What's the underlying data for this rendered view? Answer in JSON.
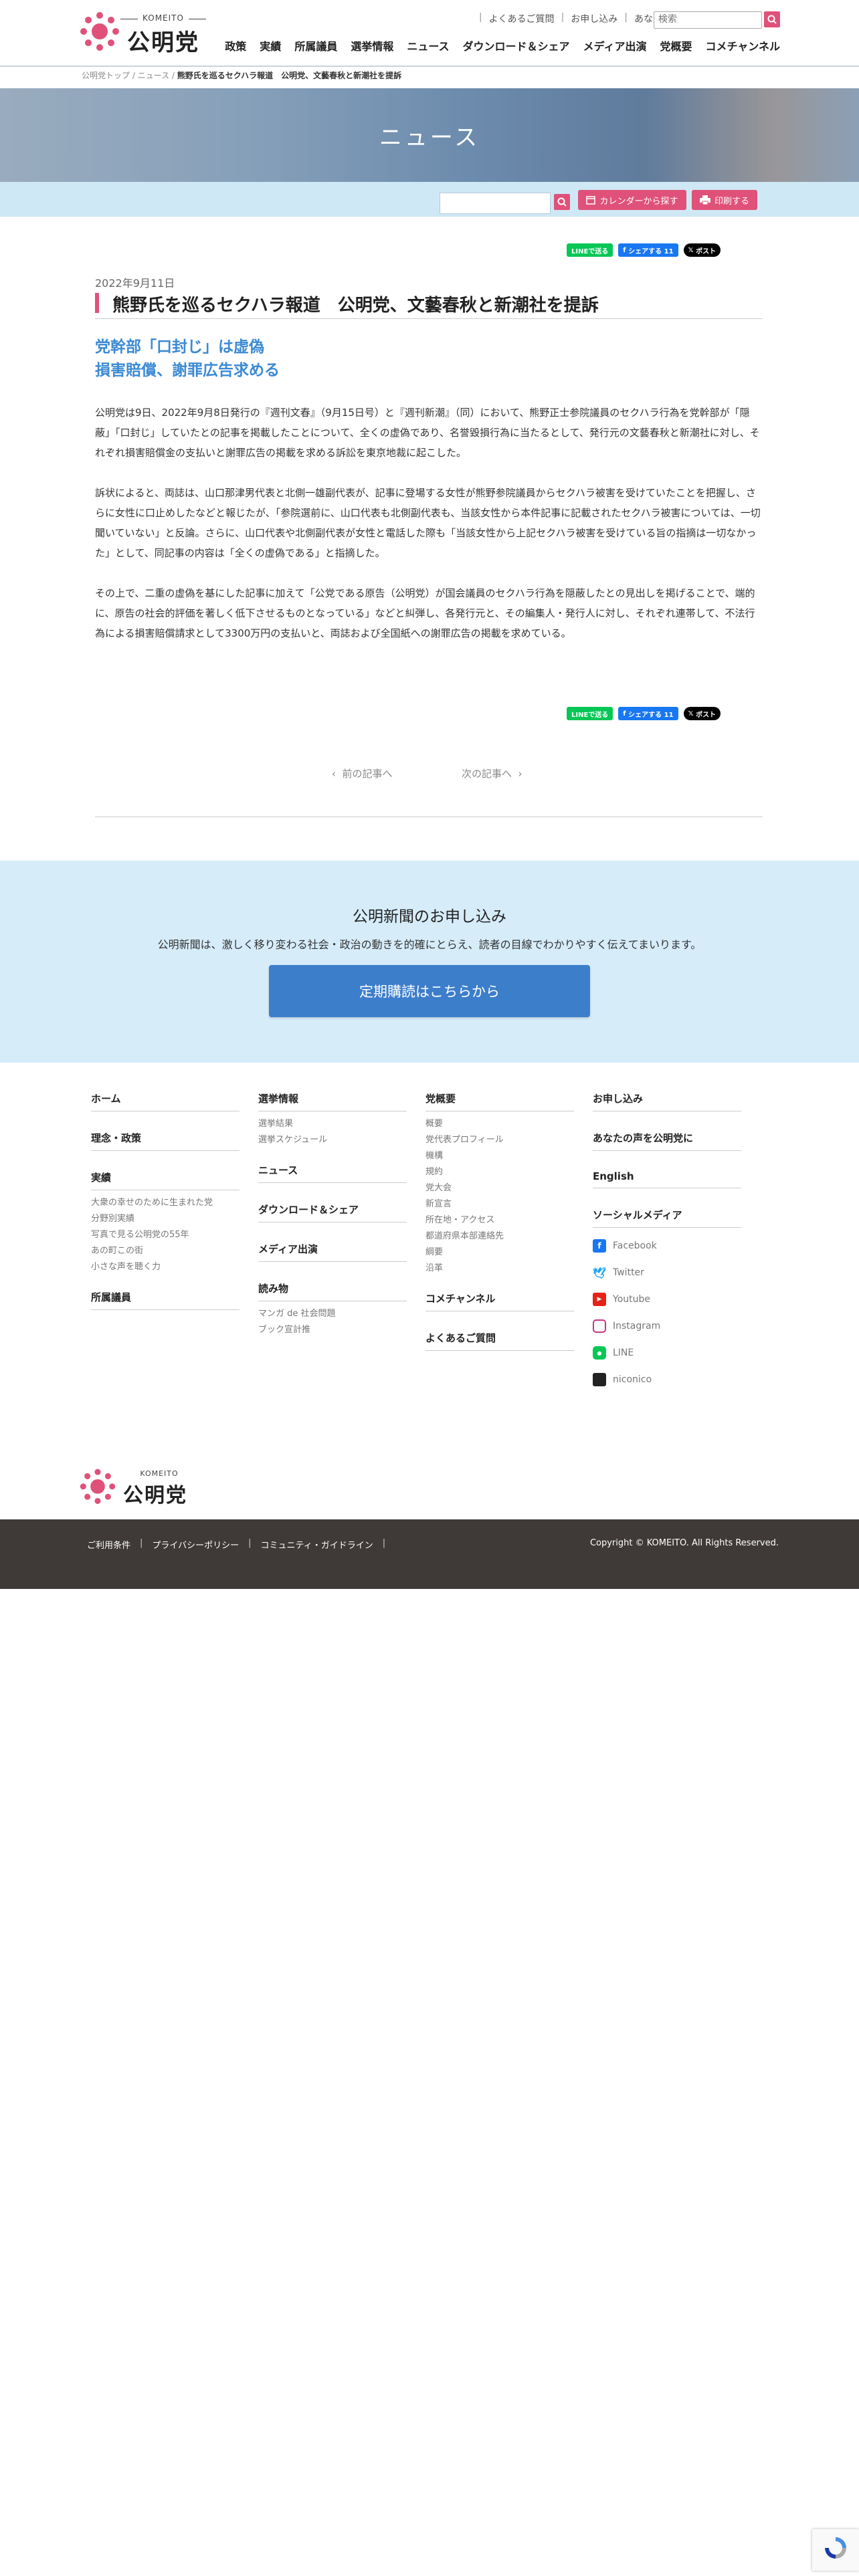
{
  "header": {
    "logo_en": "KOMEITO",
    "logo_ja": "公明党",
    "util_links": [
      "よくあるご質問",
      "お申し込み",
      "あなたの声を公明党に"
    ],
    "search_placeholder": "検索",
    "nav": [
      "政策",
      "実績",
      "所属議員",
      "選挙情報",
      "ニュース",
      "ダウンロード＆シェア",
      "メディア出演",
      "党概要",
      "コメチャンネル"
    ]
  },
  "breadcrumb": {
    "home": "公明党トップ",
    "section": "ニュース",
    "current": "熊野氏を巡るセクハラ報道　公明党、文藝春秋と新潮社を提訴",
    "sep": " / "
  },
  "banner": {
    "title": "ニュース"
  },
  "toolbar": {
    "calendar_label": "カレンダーから探す",
    "print_label": "印刷する"
  },
  "share": {
    "line": "LINEで送る",
    "facebook": "シェアする 11",
    "x": "ポスト"
  },
  "article": {
    "date": "2022年9月11日",
    "title": "熊野氏を巡るセクハラ報道　公明党、文藝春秋と新潮社を提訴",
    "lead_1": "党幹部「口封じ」は虚偽",
    "lead_2": "損害賠償、謝罪広告求める",
    "paragraphs": [
      "公明党は9日、2022年9月8日発行の『週刊文春』（9月15日号）と『週刊新潮』（同）において、熊野正士参院議員のセクハラ行為を党幹部が「隠蔽」「口封じ」していたとの記事を掲載したことについて、全くの虚偽であり、名誉毀損行為に当たるとして、発行元の文藝春秋と新潮社に対し、それぞれ損害賠償金の支払いと謝罪広告の掲載を求める訴訟を東京地裁に起こした。",
      "訴状によると、両誌は、山口那津男代表と北側一雄副代表が、記事に登場する女性が熊野参院議員からセクハラ被害を受けていたことを把握し、さらに女性に口止めしたなどと報じたが、「参院選前に、山口代表も北側副代表も、当該女性から本件記事に記載されたセクハラ被害については、一切聞いていない」と反論。さらに、山口代表や北側副代表が女性と電話した際も「当該女性から上記セクハラ被害を受けている旨の指摘は一切なかった」として、同記事の内容は「全くの虚偽である」と指摘した。",
      "その上で、二重の虚偽を基にした記事に加えて「公党である原告（公明党）が国会議員のセクハラ行為を隠蔽したとの見出しを掲げることで、端的に、原告の社会的評価を著しく低下させるものとなっている」などと糾弾し、各発行元と、その編集人・発行人に対し、それぞれ連帯して、不法行為による損害賠償請求として3300万円の支払いと、両誌および全国紙への謝罪広告の掲載を求めている。"
    ]
  },
  "pager": {
    "prev": "前の記事へ",
    "next": "次の記事へ"
  },
  "subscribe": {
    "heading": "公明新聞のお申し込み",
    "text": "公明新聞は、激しく移り変わる社会・政治の動きを的確にとらえ、読者の目線でわかりやすく伝えてまいります。",
    "cta": "定期購読はこちらから"
  },
  "footer": {
    "col1": {
      "home": "ホーム",
      "policy": "理念・政策",
      "achievements": "実績",
      "achievement_items": [
        "大衆の幸せのために生まれた党",
        "分野別実績",
        "写真で見る公明党の55年",
        "あの町この街",
        "小さな声を聴く力"
      ],
      "members": "所属議員"
    },
    "col2": {
      "election": "選挙情報",
      "election_items": [
        "選挙結果",
        "選挙スケジュール"
      ],
      "news": "ニュース",
      "download": "ダウンロード＆シェア",
      "media": "メディア出演",
      "reading": "読み物",
      "reading_items": [
        "マンガ de 社会問題",
        "ブック宣計推"
      ]
    },
    "col3": {
      "about": "党概要",
      "about_items": [
        "概要",
        "党代表プロフィール",
        "機構",
        "規約",
        "党大会",
        "新宣言",
        "所在地・アクセス",
        "都道府県本部連絡先",
        "綱要",
        "沿革"
      ],
      "channel": "コメチャンネル",
      "faq": "よくあるご質問"
    },
    "col4": {
      "apply": "お申し込み",
      "voice": "あなたの声を公明党に",
      "english": "English",
      "social": "ソーシャルメディア",
      "sns": [
        "Facebook",
        "Twitter",
        "Youtube",
        "Instagram",
        "LINE",
        "niconico"
      ]
    },
    "bottom_links": [
      "ご利用条件",
      "プライバシーポリシー",
      "コミュニティ・ガイドライン"
    ],
    "copyright": "Copyright © KOMEITO. All Rights Reserved."
  },
  "colors": {
    "accent": "#e05179",
    "lead": "#3c8ad4",
    "cta": "#3d7ecb",
    "light_blue": "#d6ecf9",
    "footer_bg": "#3f3a37"
  }
}
